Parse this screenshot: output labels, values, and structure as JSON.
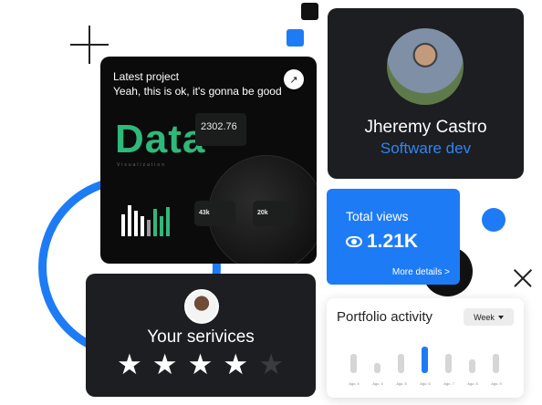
{
  "project": {
    "heading": "Latest project",
    "subheading": "Yeah, this is ok, it's gonna be good",
    "open_icon": "arrow-up-right-icon",
    "preview": {
      "headline": "Data",
      "caption": "Visualization",
      "stat": "2302.76",
      "stat_a": "43k",
      "stat_b": "20k"
    }
  },
  "profile": {
    "name": "Jheremy Castro",
    "role": "Software dev"
  },
  "views": {
    "title": "Total views",
    "value": "1.21K",
    "more": "More details >"
  },
  "services": {
    "title": "Your serivices",
    "rating": 4,
    "max": 5
  },
  "portfolio": {
    "title": "Portfolio activity",
    "range": "Week",
    "chart_data": {
      "type": "bar",
      "categories": [
        "Ago. 4",
        "Ago. 4",
        "Ago. 5",
        "Ago. 6",
        "Ago. 7",
        "Ago. 8",
        "Ago. 9"
      ],
      "values": [
        0.62,
        0.32,
        0.62,
        0.85,
        0.62,
        0.45,
        0.62
      ],
      "highlight_index": 3
    }
  },
  "colors": {
    "accent": "#1e7bf6",
    "dark": "#1c1e21",
    "green": "#2fb87a"
  }
}
